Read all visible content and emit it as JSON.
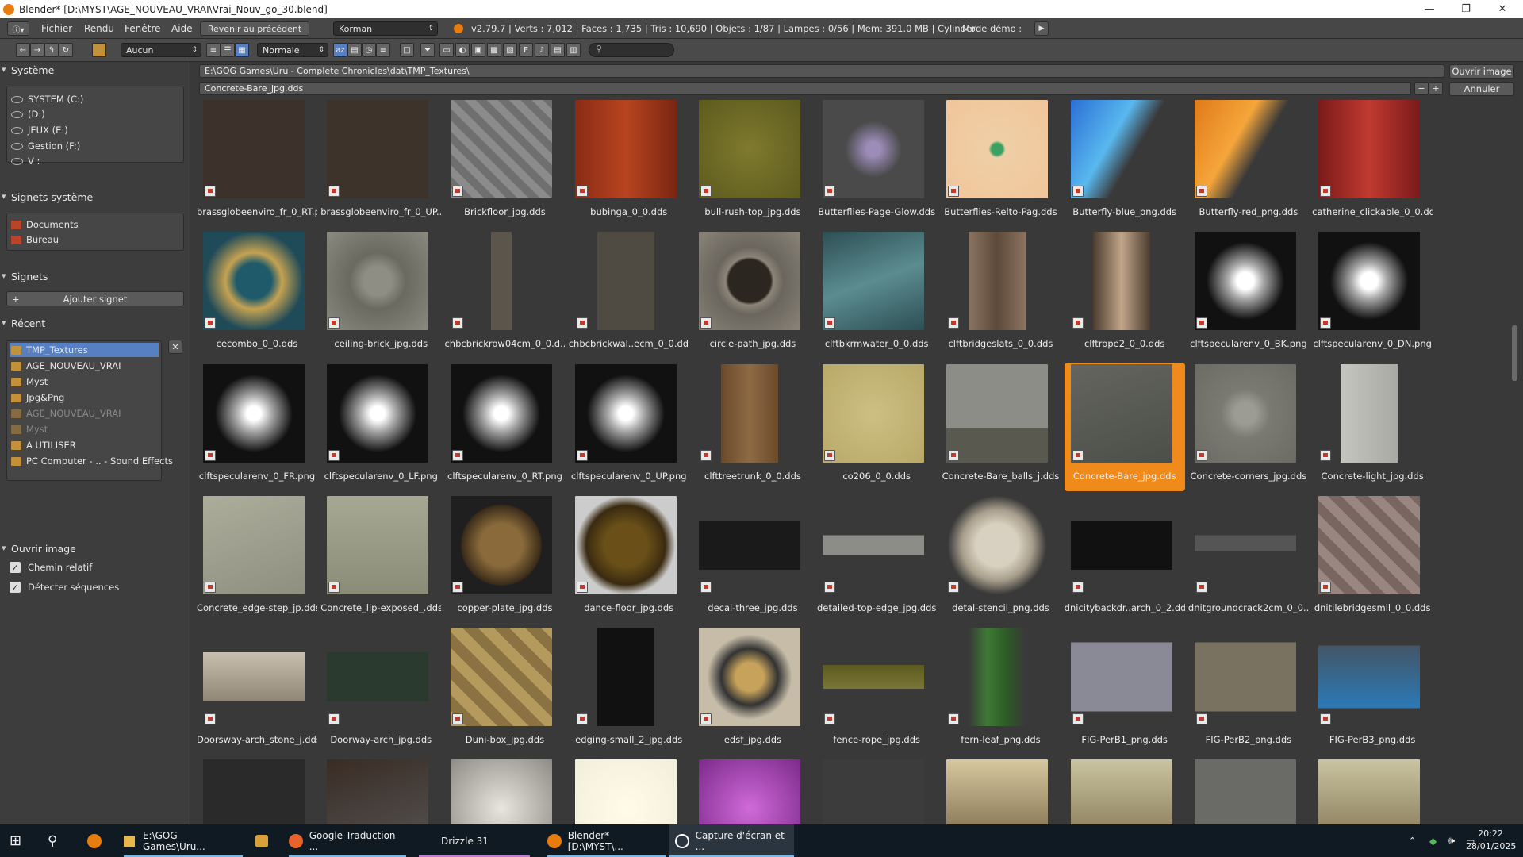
{
  "window": {
    "title": "Blender* [D:\\MYST\\AGE_NOUVEAU_VRAI\\Vrai_Nouv_go_30.blend]",
    "min": "—",
    "max": "❐",
    "close": "✕"
  },
  "infobar": {
    "menu": [
      "Fichier",
      "Rendu",
      "Fenêtre",
      "Aide"
    ],
    "back_button": "Revenir au précédent",
    "scene": "Korman",
    "stats": "v2.79.7 | Verts : 7,012 | Faces : 1,735 | Tris : 10,690 | Objets : 1/87 | Lampes : 0/56 | Mem: 391.0 MB | Cylinder",
    "demo_label": "Mode démo :"
  },
  "toolbar": {
    "filter_select": "Aucun",
    "display_select": "Normale"
  },
  "sidebar": {
    "system_header": "Système",
    "drives": [
      "SYSTEM (C:)",
      "(D:)",
      "JEUX (E:)",
      "Gestion (F:)",
      "V :"
    ],
    "sys_bookmarks_header": "Signets système",
    "sys_bookmarks": [
      "Documents",
      "Bureau"
    ],
    "bookmarks_header": "Signets",
    "add_bookmark": "Ajouter signet",
    "recent_header": "Récent",
    "recent": [
      "TMP_Textures",
      "AGE_NOUVEAU_VRAI",
      "Myst",
      "Jpg&Png",
      "AGE_NOUVEAU_VRAI",
      "Myst",
      "A UTILISER",
      "PC Computer - .. - Sound Effects"
    ],
    "open_image_header": "Ouvrir image",
    "relative_path": "Chemin relatif",
    "detect_sequences": "Détecter séquences"
  },
  "file_browser": {
    "path": "E:\\GOG Games\\Uru - Complete Chronicles\\dat\\TMP_Textures\\",
    "filename": "Concrete-Bare_jpg.dds",
    "open_button": "Ouvrir image",
    "cancel_button": "Annuler",
    "minus": "−",
    "plus": "+",
    "files": [
      "brassglobeenviro_fr_0_RT.p..",
      "brassglobeenviro_fr_0_UP...",
      "Brickfloor_jpg.dds",
      "bubinga_0_0.dds",
      "bull-rush-top_jpg.dds",
      "Butterflies-Page-Glow.dds",
      "Butterflies-Relto-Pag.dds",
      "Butterfly-blue_png.dds",
      "Butterfly-red_png.dds",
      "catherine_clickable_0_0.dds",
      "cecombo_0_0.dds",
      "ceiling-brick_jpg.dds",
      "chbcbrickrow04cm_0_0.d..",
      "chbcbrickwal..ecm_0_0.dds",
      "circle-path_jpg.dds",
      "clftbkrmwater_0_0.dds",
      "clftbridgeslats_0_0.dds",
      "clftrope2_0_0.dds",
      "clftspecularenv_0_BK.png",
      "clftspecularenv_0_DN.png",
      "clftspecularenv_0_FR.png",
      "clftspecularenv_0_LF.png",
      "clftspecularenv_0_RT.png",
      "clftspecularenv_0_UP.png",
      "clfttreetrunk_0_0.dds",
      "co206_0_0.dds",
      "Concrete-Bare_balls_j.dds",
      "Concrete-Bare_jpg.dds",
      "Concrete-corners_jpg.dds",
      "Concrete-light_jpg.dds",
      "Concrete_edge-step_jp.dds",
      "Concrete_lip-exposed_.dds",
      "copper-plate_jpg.dds",
      "dance-floor_jpg.dds",
      "decal-three_jpg.dds",
      "detailed-top-edge_jpg.dds",
      "detal-stencil_png.dds",
      "dnicitybackdr..arch_0_2.dds",
      "dnitgroundcrack2cm_0_0...",
      "dnitilebridgesmll_0_0.dds",
      "Doorsway-arch_stone_j.dds",
      "Doorway-arch_jpg.dds",
      "Duni-box_jpg.dds",
      "edging-small_2_jpg.dds",
      "edsf_jpg.dds",
      "fence-rope_jpg.dds",
      "fern-leaf_png.dds",
      "FIG-PerB1_png.dds",
      "FIG-PerB2_png.dds",
      "FIG-PerB3_png.dds",
      "",
      "",
      "",
      "",
      "",
      "",
      "",
      "",
      "",
      ""
    ],
    "selected": "Concrete-Bare_jpg.dds"
  },
  "taskbar": {
    "explorer": "E:\\GOG Games\\Uru...",
    "firefox": "Google Traduction ...",
    "drizzle": "Drizzle 31",
    "blender": "Blender* [D:\\MYST\\...",
    "capture": "Capture d'écran et ...",
    "time": "20:22",
    "date": "28/01/2025"
  }
}
